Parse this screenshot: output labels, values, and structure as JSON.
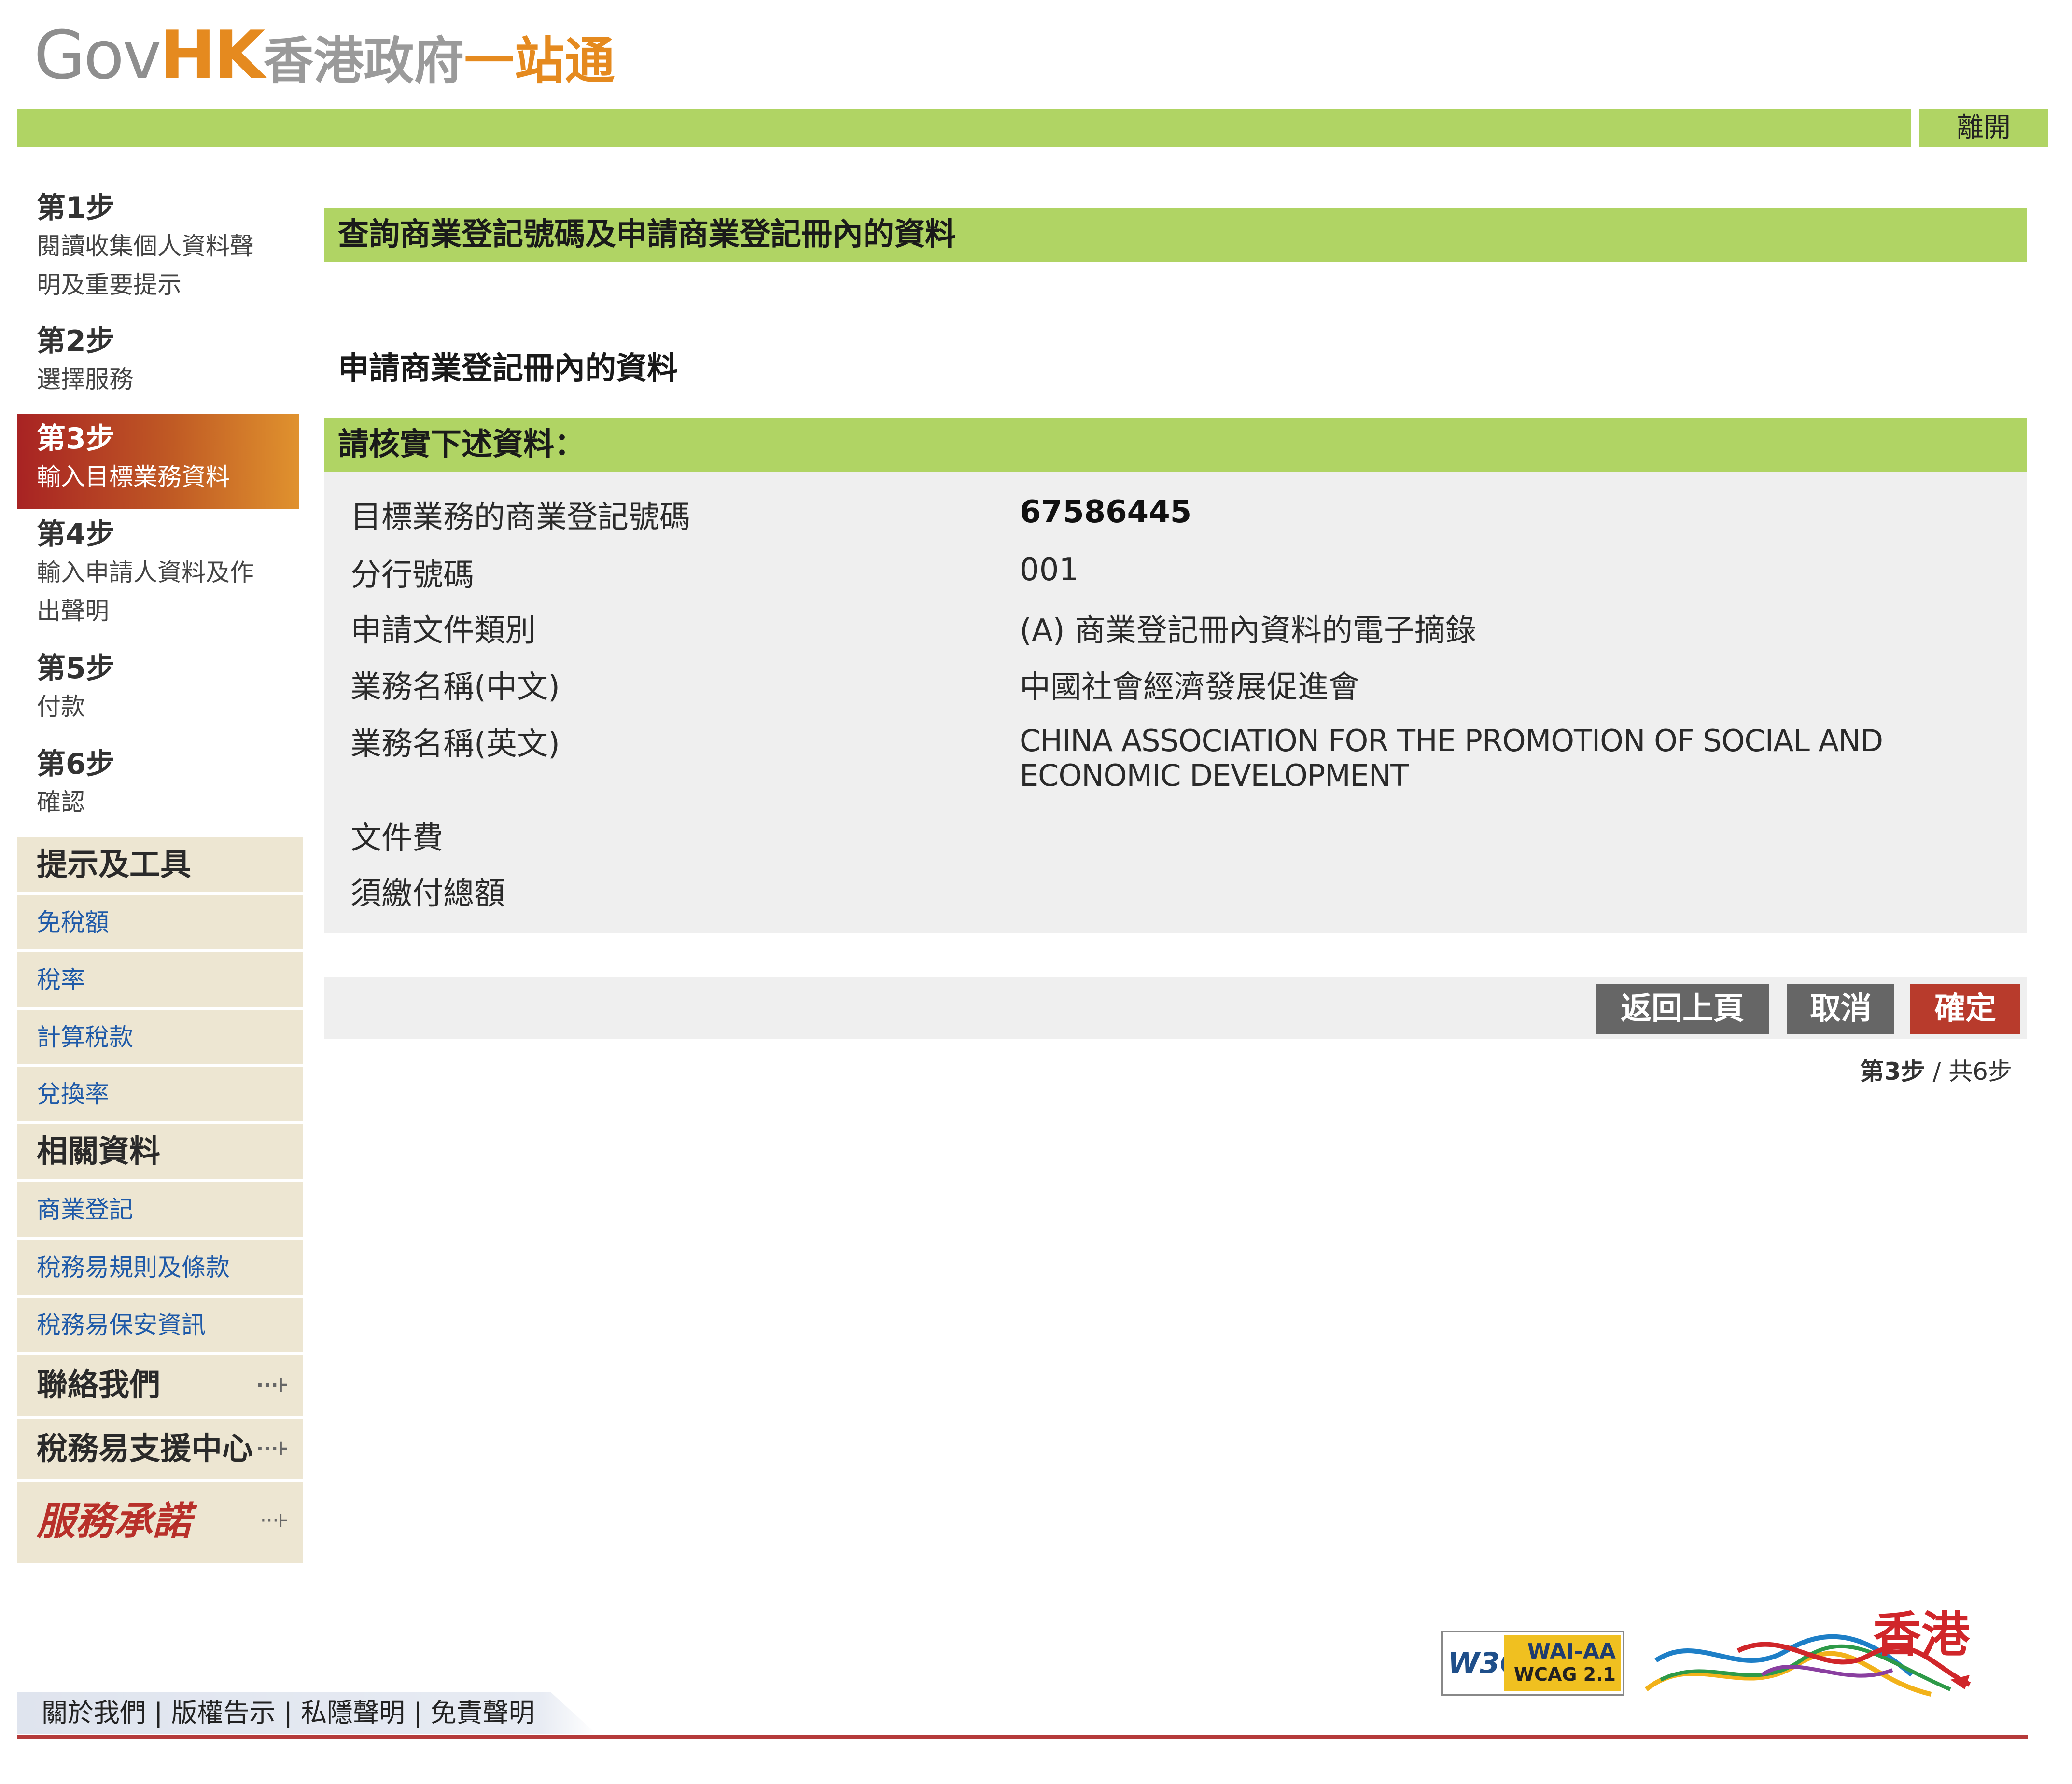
{
  "header": {
    "logo_gov": "Gov",
    "logo_hk": "HK",
    "logo_zh": "香港政府",
    "logo_zh2": "一站通",
    "exit_label": "離開"
  },
  "steps": [
    {
      "title": "第1步",
      "desc1": "閱讀收集個人資料聲",
      "desc2": "明及重要提示"
    },
    {
      "title": "第2步",
      "desc1": "選擇服務"
    },
    {
      "title": "第3步",
      "desc1": "輸入目標業務資料"
    },
    {
      "title": "第4步",
      "desc1": "輸入申請人資料及作",
      "desc2": "出聲明"
    },
    {
      "title": "第5步",
      "desc1": "付款"
    },
    {
      "title": "第6步",
      "desc1": "確認"
    }
  ],
  "tools": {
    "heading": "提示及工具",
    "links": [
      "免稅額",
      "稅率",
      "計算稅款",
      "兌換率"
    ]
  },
  "related": {
    "heading": "相關資料",
    "links": [
      "商業登記",
      "稅務易規則及條款",
      "稅務易保安資訊"
    ]
  },
  "contact": "聯絡我們",
  "support": "稅務易支援中心",
  "pledge": "服務承諾",
  "main": {
    "page_title": "查詢商業登記號碼及申請商業登記冊內的資料",
    "section_title": "申請商業登記冊內的資料",
    "verify_title": "請核實下述資料：",
    "fields": [
      {
        "label": "目標業務的商業登記號碼",
        "value": "67586445"
      },
      {
        "label": "分行號碼",
        "value": "001"
      },
      {
        "label": "申請文件類別",
        "value": "(A) 商業登記冊內資料的電子摘錄"
      },
      {
        "label": "業務名稱(中文)",
        "value": "中國社會經濟發展促進會"
      },
      {
        "label": "業務名稱(英文)",
        "value1": "CHINA ASSOCIATION FOR THE PROMOTION OF SOCIAL AND",
        "value2": "ECONOMIC DEVELOPMENT"
      },
      {
        "label": "文件費",
        "value": ""
      },
      {
        "label": "須繳付總額",
        "value": ""
      }
    ],
    "buttons": {
      "back": "返回上頁",
      "cancel": "取消",
      "confirm": "確定"
    },
    "step_current": "第3步",
    "step_sep": " / ",
    "step_total": "共6步"
  },
  "footer": {
    "links": [
      "關於我們",
      "版權告示",
      "私隱聲明",
      "免責聲明"
    ],
    "sep": " | ",
    "wcag_w3c": "W3C",
    "wcag_line1": "WAI-AA",
    "wcag_line2": "WCAG 2.1",
    "brand": "香港"
  },
  "colors": {
    "bar_green": "#b0d464",
    "active_step": "#a82323",
    "button_grey": "#666666",
    "button_red": "#b83b2c",
    "link_blue": "#1f5aa8"
  }
}
